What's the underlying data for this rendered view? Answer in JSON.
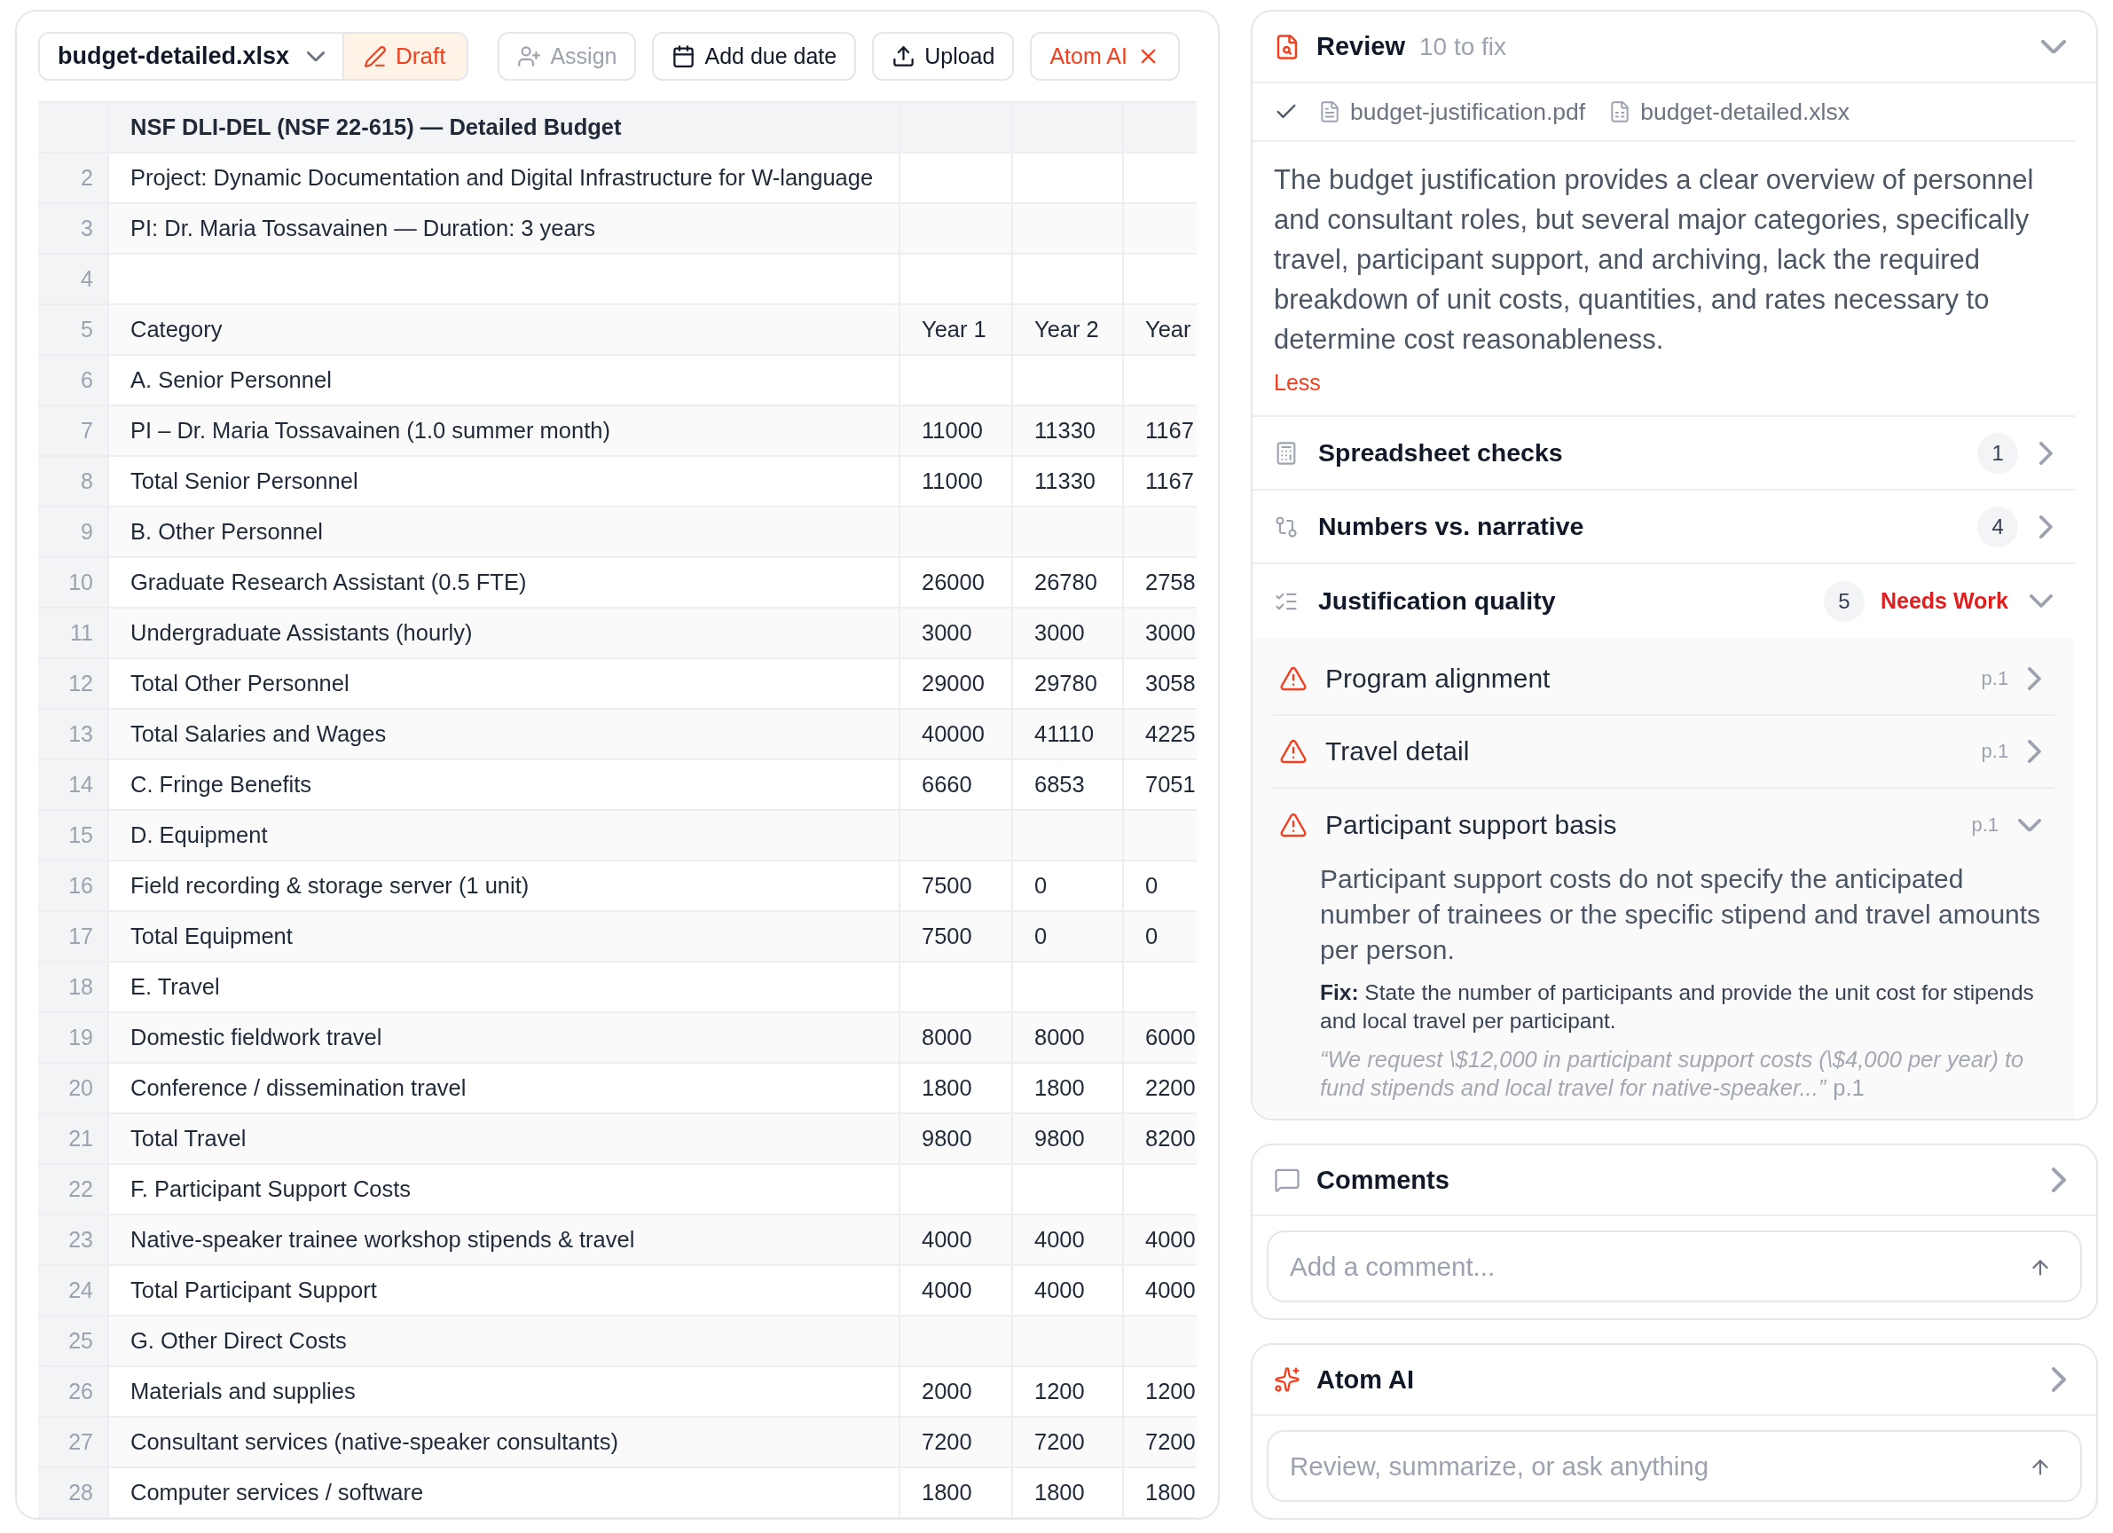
{
  "toolbar": {
    "file": {
      "name": "budget-detailed.xlsx"
    },
    "status": {
      "label": "Draft"
    },
    "buttons": [
      {
        "kind": "assign",
        "label": "Assign",
        "disabled": true
      },
      {
        "kind": "due_date",
        "label": "Add due date",
        "disabled": false
      },
      {
        "kind": "upload",
        "label": "Upload",
        "disabled": false
      },
      {
        "kind": "ai",
        "label": "Atom AI",
        "disabled": false
      }
    ]
  },
  "sheet": {
    "rows": [
      {
        "kind": "title",
        "column_1": "NSF DLI-DEL (NSF 22-615) — Detailed Budget"
      },
      {
        "kind": "data",
        "number": "2",
        "column_1": "Project: Dynamic Documentation and Digital Infrastructure for W-language"
      },
      {
        "kind": "data",
        "number": "3",
        "column_1": "PI: Dr. Maria Tossavainen — Duration: 3 years"
      },
      {
        "kind": "data",
        "number": "4"
      },
      {
        "kind": "data",
        "number": "5",
        "column_1": "Category",
        "column_2": "Year 1",
        "column_3": "Year 2",
        "column_4": "Year"
      },
      {
        "kind": "data",
        "number": "6",
        "column_1": "A. Senior Personnel"
      },
      {
        "kind": "data",
        "number": "7",
        "column_1": "PI – Dr. Maria Tossavainen (1.0 summer month)",
        "column_2": "11000",
        "column_3": "11330",
        "column_4": "1167"
      },
      {
        "kind": "data",
        "number": "8",
        "column_1": "Total Senior Personnel",
        "column_2": "11000",
        "column_3": "11330",
        "column_4": "1167"
      },
      {
        "kind": "data",
        "number": "9",
        "column_1": "B. Other Personnel"
      },
      {
        "kind": "data",
        "number": "10",
        "column_1": "Graduate Research Assistant (0.5 FTE)",
        "column_2": "26000",
        "column_3": "26780",
        "column_4": "2758"
      },
      {
        "kind": "data",
        "number": "11",
        "column_1": "Undergraduate Assistants (hourly)",
        "column_2": "3000",
        "column_3": "3000",
        "column_4": "3000"
      },
      {
        "kind": "data",
        "number": "12",
        "column_1": "Total Other Personnel",
        "column_2": "29000",
        "column_3": "29780",
        "column_4": "3058"
      },
      {
        "kind": "data",
        "number": "13",
        "column_1": "Total Salaries and Wages",
        "column_2": "40000",
        "column_3": "41110",
        "column_4": "4225"
      },
      {
        "kind": "data",
        "number": "14",
        "column_1": "C. Fringe Benefits",
        "column_2": "6660",
        "column_3": "6853",
        "column_4": "7051"
      },
      {
        "kind": "data",
        "number": "15",
        "column_1": "D. Equipment"
      },
      {
        "kind": "data",
        "number": "16",
        "column_1": "Field recording & storage server (1 unit)",
        "column_2": "7500",
        "column_3": "0",
        "column_4": "0"
      },
      {
        "kind": "data",
        "number": "17",
        "column_1": "Total Equipment",
        "column_2": "7500",
        "column_3": "0",
        "column_4": "0"
      },
      {
        "kind": "data",
        "number": "18",
        "column_1": "E. Travel"
      },
      {
        "kind": "data",
        "number": "19",
        "column_1": "Domestic fieldwork travel",
        "column_2": "8000",
        "column_3": "8000",
        "column_4": "6000"
      },
      {
        "kind": "data",
        "number": "20",
        "column_1": "Conference / dissemination travel",
        "column_2": "1800",
        "column_3": "1800",
        "column_4": "2200"
      },
      {
        "kind": "data",
        "number": "21",
        "column_1": "Total Travel",
        "column_2": "9800",
        "column_3": "9800",
        "column_4": "8200"
      },
      {
        "kind": "data",
        "number": "22",
        "column_1": "F. Participant Support Costs"
      },
      {
        "kind": "data",
        "number": "23",
        "column_1": "Native-speaker trainee workshop stipends & travel",
        "column_2": "4000",
        "column_3": "4000",
        "column_4": "4000"
      },
      {
        "kind": "data",
        "number": "24",
        "column_1": "Total Participant Support",
        "column_2": "4000",
        "column_3": "4000",
        "column_4": "4000"
      },
      {
        "kind": "data",
        "number": "25",
        "column_1": "G. Other Direct Costs"
      },
      {
        "kind": "data",
        "number": "26",
        "column_1": "Materials and supplies",
        "column_2": "2000",
        "column_3": "1200",
        "column_4": "1200"
      },
      {
        "kind": "data",
        "number": "27",
        "column_1": "Consultant services (native-speaker consultants)",
        "column_2": "7200",
        "column_3": "7200",
        "column_4": "7200"
      },
      {
        "kind": "data",
        "number": "28",
        "column_1": "Computer services / software",
        "column_2": "1800",
        "column_3": "1800",
        "column_4": "1800"
      }
    ]
  },
  "review": {
    "title": "Review",
    "count": "10 to fix",
    "expanded": true,
    "files": [
      {
        "kind": "pdf",
        "name": "budget-justification.pdf"
      },
      {
        "kind": "sheet",
        "name": "budget-detailed.xlsx"
      }
    ],
    "summary": "The budget justification provides a clear overview of personnel and consultant roles, but several major categories, specifically travel, participant support, and archiving, lack the required breakdown of unit costs, quantities, and rates necessary to determine cost reasonableness.",
    "summary_toggle": "Less",
    "sections": [
      {
        "kind": "spreadsheet",
        "title": "Spreadsheet checks",
        "count": "1",
        "expanded": false
      },
      {
        "kind": "compare",
        "title": "Numbers vs. narrative",
        "count": "4",
        "expanded": false
      },
      {
        "kind": "quality",
        "title": "Justification quality",
        "count": "5",
        "status": "Needs Work",
        "expanded": true,
        "issues": [
          {
            "title": "Program alignment",
            "page": "p.1",
            "expanded": false
          },
          {
            "title": "Travel detail",
            "page": "p.1",
            "expanded": false
          },
          {
            "title": "Participant support basis",
            "page": "p.1",
            "expanded": true,
            "description": "Participant support costs do not specify the anticipated number of trainees or the specific stipend and travel amounts per person.",
            "fix": "**Fix:** State the number of participants and provide the unit cost for stipends and local travel per participant.",
            "quote": "“We request \\$12,000 in participant support costs (\\$4,000 per year) to fund stipends and local travel for native-speaker...”",
            "quote_page": "p.1"
          }
        ]
      }
    ]
  },
  "comments": {
    "title": "Comments",
    "expanded": false,
    "input": {
      "placeholder": "Add a comment..."
    }
  },
  "assistant": {
    "title": "Atom AI",
    "expanded": false,
    "input": {
      "placeholder": "Review, summarize, or ask anything"
    }
  }
}
